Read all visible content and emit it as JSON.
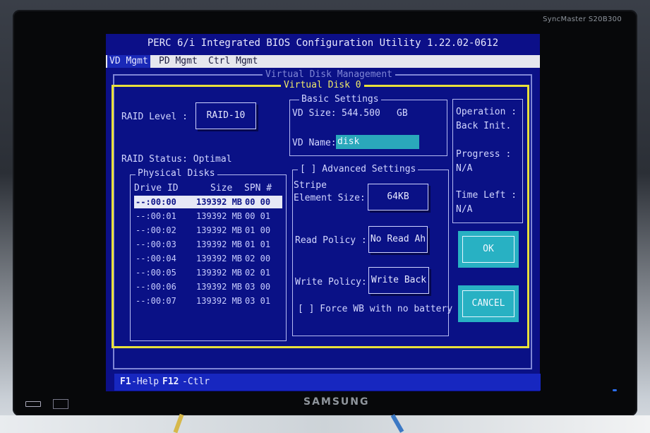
{
  "monitor": {
    "model_label": "SyncMaster S20B300",
    "brand": "SAMSUNG"
  },
  "bios": {
    "title": "PERC 6/i Integrated BIOS Configuration Utility 1.22.02-0612",
    "menu": [
      "VD Mgmt",
      "PD Mgmt",
      "Ctrl Mgmt"
    ],
    "active_menu": "VD Mgmt",
    "panel_title": "Virtual Disk Management",
    "vd_title": "Virtual Disk 0",
    "raid_level_label": "RAID Level :",
    "raid_level_value": "RAID-10",
    "raid_status": "RAID Status: Optimal",
    "physical_disks": {
      "title": "Physical Disks",
      "headers": [
        "Drive ID",
        "Size",
        "SPN #"
      ],
      "rows": [
        {
          "id": "--:00:00",
          "size": "139392 MB",
          "spn": "00 00",
          "selected": true
        },
        {
          "id": "--:00:01",
          "size": "139392 MB",
          "spn": "00 01",
          "selected": false
        },
        {
          "id": "--:00:02",
          "size": "139392 MB",
          "spn": "01 00",
          "selected": false
        },
        {
          "id": "--:00:03",
          "size": "139392 MB",
          "spn": "01 01",
          "selected": false
        },
        {
          "id": "--:00:04",
          "size": "139392 MB",
          "spn": "02 00",
          "selected": false
        },
        {
          "id": "--:00:05",
          "size": "139392 MB",
          "spn": "02 01",
          "selected": false
        },
        {
          "id": "--:00:06",
          "size": "139392 MB",
          "spn": "03 00",
          "selected": false
        },
        {
          "id": "--:00:07",
          "size": "139392 MB",
          "spn": "03 01",
          "selected": false
        }
      ]
    },
    "basic_settings": {
      "title": "Basic Settings",
      "vd_size_label": "VD Size:",
      "vd_size_value": "544.500",
      "vd_size_unit": "GB",
      "vd_name_label": "VD Name:",
      "vd_name_value": "disk"
    },
    "advanced_settings": {
      "title": "[ ] Advanced Settings",
      "stripe_label_1": "Stripe",
      "stripe_label_2": "Element Size:",
      "stripe_value": "64KB",
      "read_policy_label": "Read Policy :",
      "read_policy_value": "No Read Ah",
      "write_policy_label": "Write Policy:",
      "write_policy_value": "Write Back",
      "force_wb": "[ ] Force WB with no battery"
    },
    "operation": {
      "label": "Operation :",
      "value": "Back Init.",
      "progress_label": "Progress :",
      "progress_value": "N/A",
      "time_left_label": "Time Left :",
      "time_left_value": "N/A"
    },
    "buttons": {
      "ok": "OK",
      "cancel": "CANCEL"
    },
    "status_bar": {
      "f1_key": "F1",
      "f1_text": "-Help",
      "f12_key": "F12",
      "f12_text": "-Ctlr"
    }
  },
  "colors": {
    "screen_bg": "#0c0f88",
    "selection_bg": "#e6e8f6",
    "accent_yellow": "#e8e03a",
    "accent_cyan": "#28b1c3",
    "status_bar": "#1727c0"
  }
}
